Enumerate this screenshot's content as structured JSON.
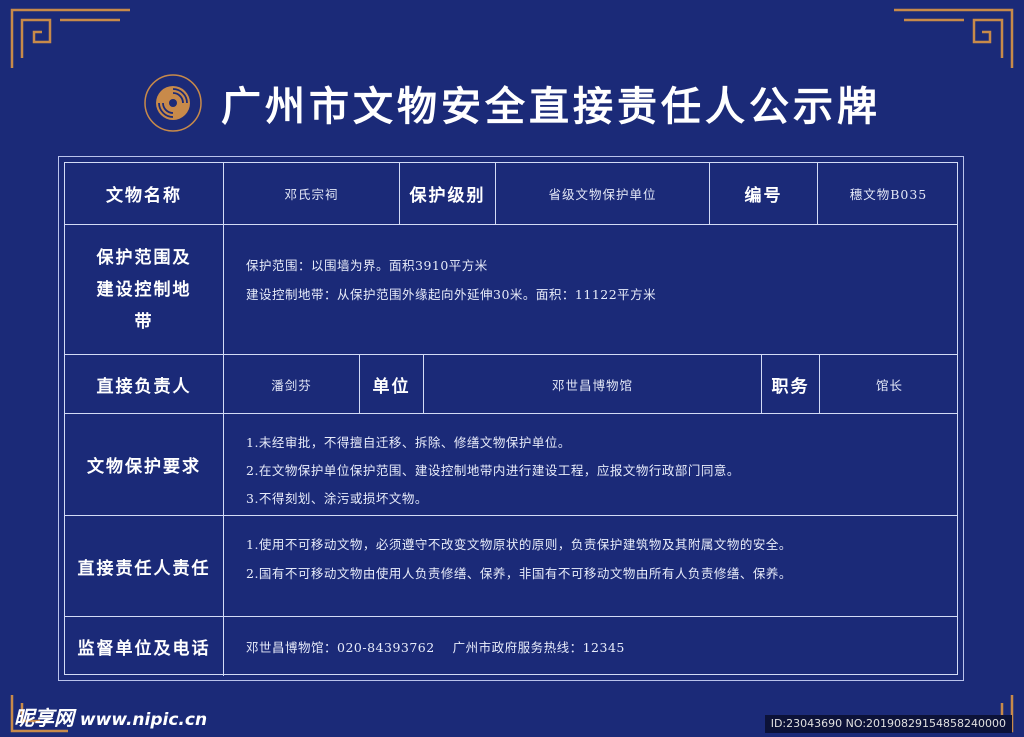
{
  "header": {
    "title": "广州市文物安全直接责任人公示牌",
    "logo_icon": "cultural-heritage-logo"
  },
  "colors": {
    "background": "#1b2a78",
    "border": "#d3dbf6",
    "ornament": "#c88a4a"
  },
  "row1": {
    "name_label": "文物名称",
    "name_value": "邓氏宗祠",
    "level_label": "保护级别",
    "level_value": "省级文物保护单位",
    "number_label": "编号",
    "number_value": "穗文物B035"
  },
  "row2": {
    "label": "保护范围及建设控制地带",
    "lines": [
      "保护范围：以围墙为界。面积3910平方米",
      "建设控制地带：从保护范围外缘起向外延伸30米。面积：11122平方米"
    ]
  },
  "row3": {
    "person_label": "直接负责人",
    "person_value": "潘剑芬",
    "unit_label": "单位",
    "unit_value": "邓世昌博物馆",
    "position_label": "职务",
    "position_value": "馆长"
  },
  "row4": {
    "label": "文物保护要求",
    "lines": [
      "1.未经审批，不得擅自迁移、拆除、修缮文物保护单位。",
      "2.在文物保护单位保护范围、建设控制地带内进行建设工程，应报文物行政部门同意。",
      "3.不得刻划、涂污或损坏文物。"
    ]
  },
  "row5": {
    "label": "直接责任人责任",
    "lines": [
      "1.使用不可移动文物，必须遵守不改变文物原状的原则，负责保护建筑物及其附属文物的安全。",
      "2.国有不可移动文物由使用人负责修缮、保养，非国有不可移动文物由所有人负责修缮、保养。"
    ]
  },
  "row6": {
    "label": "监督单位及电话",
    "value": "邓世昌博物馆：020-84393762    广州市政府服务热线：12345"
  },
  "watermark": {
    "brand": "昵享网",
    "url": "www.nipic.cn",
    "id_text": "ID:23043690 NO:20190829154858240000"
  }
}
